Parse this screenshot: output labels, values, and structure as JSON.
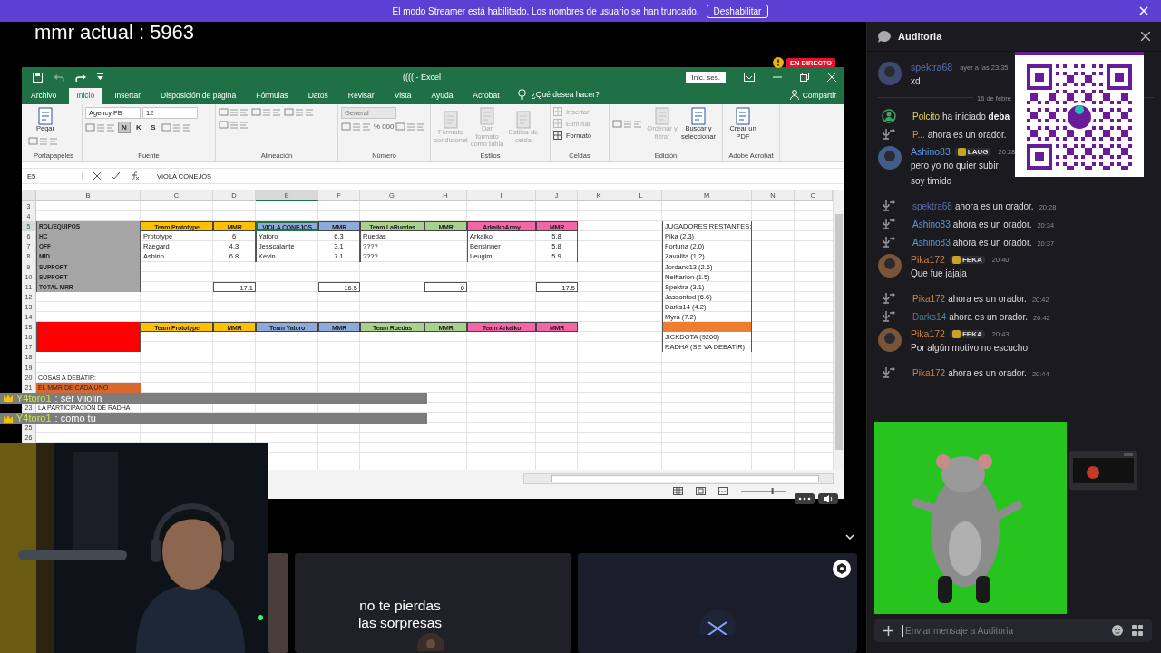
{
  "banner": {
    "text": "El modo Streamer está habilitado. Los nombres de usuario se han truncado.",
    "button": "Deshabilitar"
  },
  "stream": {
    "overlay_text": "mmr actual : 5963",
    "live_badge": "EN DIRECTO",
    "excel": {
      "title": "(((( - Excel",
      "sign_in": "Inic. ses.",
      "tabs": [
        {
          "label": "Archivo",
          "selected": false
        },
        {
          "label": "Inicio",
          "selected": true
        },
        {
          "label": "Insertar",
          "selected": false
        },
        {
          "label": "Disposición de página",
          "selected": false
        },
        {
          "label": "Fórmulas",
          "selected": false
        },
        {
          "label": "Datos",
          "selected": false
        },
        {
          "label": "Revisar",
          "selected": false
        },
        {
          "label": "Vista",
          "selected": false
        },
        {
          "label": "Ayuda",
          "selected": false
        },
        {
          "label": "Acrobat",
          "selected": false
        }
      ],
      "tell_me": "¿Qué desea hacer?",
      "share": "Compartir",
      "ribbon": [
        {
          "label": "Portapapeles",
          "items": [
            {
              "kind": "big",
              "label": "Pegar",
              "disabled": false
            },
            {
              "kind": "tools"
            }
          ]
        },
        {
          "label": "Fuente",
          "items": [
            {
              "kind": "select",
              "value": "Agency FB",
              "disabled": false
            },
            {
              "kind": "select",
              "value": "12",
              "disabled": false
            },
            {
              "kind": "tools"
            },
            {
              "kind": "letter",
              "label": "N",
              "selected": true
            },
            {
              "kind": "letter",
              "label": "K",
              "selected": false
            },
            {
              "kind": "letter",
              "label": "S",
              "selected": false
            },
            {
              "kind": "tools"
            }
          ]
        },
        {
          "label": "Alineación",
          "items": [
            {
              "kind": "tools"
            },
            {
              "kind": "tools"
            },
            {
              "kind": "tools"
            },
            {
              "kind": "tools"
            }
          ]
        },
        {
          "label": "Número",
          "items": [
            {
              "kind": "select",
              "value": "General",
              "disabled": true
            },
            {
              "kind": "tools"
            },
            {
              "kind": "glyph",
              "label": "%"
            },
            {
              "kind": "glyph",
              "label": "000"
            },
            {
              "kind": "tools"
            }
          ]
        },
        {
          "label": "Estilos",
          "items": [
            {
              "kind": "big",
              "label": "Formato condicional",
              "disabled": true
            },
            {
              "kind": "big",
              "label": "Dar formato como tabla",
              "disabled": true
            },
            {
              "kind": "big",
              "label": "Estilos de celda",
              "disabled": true
            }
          ]
        },
        {
          "label": "Celdas",
          "items": [
            {
              "kind": "small",
              "label": "Insertar",
              "disabled": true
            },
            {
              "kind": "small",
              "label": "Eliminar",
              "disabled": true
            },
            {
              "kind": "small",
              "label": "Formato",
              "disabled": false
            }
          ]
        },
        {
          "label": "Edición",
          "items": [
            {
              "kind": "tools"
            },
            {
              "kind": "big",
              "label": "Ordenar y filtrar",
              "disabled": true
            },
            {
              "kind": "big",
              "label": "Buscar y seleccionar",
              "disabled": false
            }
          ]
        },
        {
          "label": "Adobe Acrobat",
          "items": [
            {
              "kind": "big",
              "label": "Crear un PDF",
              "disabled": false
            }
          ]
        }
      ],
      "name_box": "E5",
      "formula": "VIOLA CONEJOS",
      "columns": [
        {
          "letter": "B",
          "selected": false
        },
        {
          "letter": "C",
          "selected": false
        },
        {
          "letter": "D",
          "selected": false
        },
        {
          "letter": "E",
          "selected": true
        },
        {
          "letter": "F",
          "selected": false
        },
        {
          "letter": "G",
          "selected": false
        },
        {
          "letter": "H",
          "selected": false
        },
        {
          "letter": "I",
          "selected": false
        },
        {
          "letter": "J",
          "selected": false
        },
        {
          "letter": "K",
          "selected": false
        },
        {
          "letter": "L",
          "selected": false
        },
        {
          "letter": "M",
          "selected": false
        },
        {
          "letter": "N",
          "selected": false
        },
        {
          "letter": "O",
          "selected": false
        }
      ],
      "rows": [
        {
          "number": "3",
          "selected": false
        },
        {
          "number": "4",
          "selected": false
        },
        {
          "number": "5",
          "selected": true,
          "cells": [
            {
              "kind": "label",
              "text": "ROL/EQUIPOS",
              "color": "#a6a6a6"
            },
            {
              "kind": "header",
              "text": "Team Prototype",
              "color": "#ffc000"
            },
            {
              "kind": "header",
              "text": "MMR",
              "color": "#ffc000"
            },
            {
              "kind": "header",
              "text": "VIOLA CONEJOS",
              "color": "#8eaadb"
            },
            {
              "kind": "header",
              "text": "MMR",
              "color": "#8eaadb"
            },
            {
              "kind": "header",
              "text": "Team LaRuedas",
              "color": "#a9d18e"
            },
            {
              "kind": "header",
              "text": "MMR",
              "color": "#a9d18e"
            },
            {
              "kind": "header",
              "text": "ArkaikoArmy",
              "color": "#f466a8"
            },
            {
              "kind": "header",
              "text": "MMR",
              "color": "#f466a8"
            },
            {},
            {},
            {
              "kind": "list",
              "text": "JUGADORES RESTANTES:"
            }
          ]
        },
        {
          "number": "6",
          "selected": false,
          "cells": [
            {
              "kind": "label",
              "text": "HC",
              "color": "#a6a6a6"
            },
            {
              "kind": "text",
              "text": "Prototype"
            },
            {
              "kind": "number",
              "text": "6"
            },
            {
              "kind": "text",
              "text": "Yatoro"
            },
            {
              "kind": "number",
              "text": "6.3"
            },
            {
              "kind": "text",
              "text": "Ruedas"
            },
            {},
            {
              "kind": "text",
              "text": "Arkaiko"
            },
            {
              "kind": "number",
              "text": "5.8"
            },
            {},
            {},
            {
              "kind": "list",
              "text": "Pika (2.3)"
            }
          ]
        },
        {
          "number": "7",
          "selected": false,
          "cells": [
            {
              "kind": "label",
              "text": "OFF",
              "color": "#a6a6a6"
            },
            {
              "kind": "text",
              "text": "Raegard"
            },
            {
              "kind": "number",
              "text": "4.3"
            },
            {
              "kind": "text",
              "text": "Jesscalante"
            },
            {
              "kind": "number",
              "text": "3.1"
            },
            {
              "kind": "text",
              "text": "????"
            },
            {},
            {
              "kind": "text",
              "text": "Bensinner"
            },
            {
              "kind": "number",
              "text": "5.8"
            },
            {},
            {},
            {
              "kind": "list",
              "text": "Fortuna (2.0)"
            }
          ]
        },
        {
          "number": "8",
          "selected": false,
          "cells": [
            {
              "kind": "label",
              "text": "MID",
              "color": "#a6a6a6"
            },
            {
              "kind": "text",
              "text": "Ashino"
            },
            {
              "kind": "number",
              "text": "6.8"
            },
            {
              "kind": "text",
              "text": "Kevin"
            },
            {
              "kind": "number",
              "text": "7.1"
            },
            {
              "kind": "text",
              "text": "????"
            },
            {},
            {
              "kind": "text",
              "text": "Leugim"
            },
            {
              "kind": "number",
              "text": "5.9"
            },
            {},
            {},
            {
              "kind": "list",
              "text": "Zavalita (1.2)"
            }
          ]
        },
        {
          "number": "9",
          "selected": false,
          "cells": [
            {
              "kind": "label",
              "text": "SUPPORT",
              "color": "#a6a6a6"
            },
            {},
            {},
            {},
            {},
            {},
            {},
            {},
            {},
            {},
            {},
            {
              "kind": "list",
              "text": "Jordanc13 (2.6)"
            }
          ]
        },
        {
          "number": "10",
          "selected": false,
          "cells": [
            {
              "kind": "label",
              "text": "SUPPORT",
              "color": "#a6a6a6"
            },
            {},
            {},
            {},
            {},
            {},
            {},
            {},
            {},
            {},
            {},
            {
              "kind": "list",
              "text": "Nelftarion (1.5)"
            }
          ]
        },
        {
          "number": "11",
          "selected": false,
          "cells": [
            {
              "kind": "label",
              "text": "TOTAL MRR",
              "color": "#a6a6a6"
            },
            {},
            {
              "kind": "total",
              "text": "17.1"
            },
            {},
            {
              "kind": "total",
              "text": "16.5"
            },
            {},
            {
              "kind": "total",
              "text": "0"
            },
            {},
            {
              "kind": "total",
              "text": "17.5"
            },
            {},
            {},
            {
              "kind": "list",
              "text": "Spektra (3.1)"
            }
          ]
        },
        {
          "number": "12",
          "selected": false,
          "cells": [
            {},
            {},
            {},
            {},
            {},
            {},
            {},
            {},
            {},
            {},
            {},
            {
              "kind": "list",
              "text": "Jassontod (6.6)"
            }
          ]
        },
        {
          "number": "13",
          "selected": false,
          "cells": [
            {},
            {},
            {},
            {},
            {},
            {},
            {},
            {},
            {},
            {},
            {},
            {
              "kind": "list",
              "text": "Darks14 (4.2)"
            }
          ]
        },
        {
          "number": "14",
          "selected": false,
          "cells": [
            {},
            {},
            {},
            {},
            {},
            {},
            {},
            {},
            {},
            {},
            {},
            {
              "kind": "list",
              "text": "Myra (7.2)"
            }
          ]
        },
        {
          "number": "15",
          "selected": false,
          "cells": [
            {
              "kind": "label",
              "color": "#ff0000"
            },
            {
              "kind": "header",
              "text": "Team Prototype",
              "color": "#ffc000"
            },
            {
              "kind": "header",
              "text": "MMR",
              "color": "#ffc000"
            },
            {
              "kind": "header",
              "text": "Team Yatoro",
              "color": "#8eaadb"
            },
            {
              "kind": "header",
              "text": "MMR",
              "color": "#8eaadb"
            },
            {
              "kind": "header",
              "text": "Team Ruedas",
              "color": "#a9d18e"
            },
            {
              "kind": "header",
              "text": "MMR",
              "color": "#a9d18e"
            },
            {
              "kind": "header",
              "text": "Team Arkaiko",
              "color": "#f466a8"
            },
            {
              "kind": "header",
              "text": "MMR",
              "color": "#f466a8"
            },
            {},
            {},
            {
              "kind": "list",
              "color": "#ed7d31"
            }
          ]
        },
        {
          "number": "16",
          "selected": false,
          "cells": [
            {
              "kind": "label",
              "color": "#ff0000"
            },
            {},
            {},
            {},
            {},
            {},
            {},
            {},
            {},
            {},
            {},
            {
              "kind": "list",
              "text": "JICKDOTA (9200)"
            }
          ]
        },
        {
          "number": "17",
          "selected": false,
          "cells": [
            {
              "kind": "label",
              "color": "#ff0000"
            },
            {},
            {},
            {},
            {},
            {},
            {},
            {},
            {},
            {},
            {},
            {
              "kind": "list",
              "text": "RADHA (SE VA DEBATIR)"
            }
          ]
        },
        {
          "number": "18",
          "selected": false
        },
        {
          "number": "19",
          "selected": false
        },
        {
          "number": "20",
          "selected": false,
          "cells": [
            {
              "kind": "note",
              "text": "COSAS A DEBATIR:"
            }
          ]
        },
        {
          "number": "21",
          "selected": false,
          "cells": [
            {
              "kind": "note",
              "text": "EL MMR DE CADA UNO",
              "color": "#d8692e"
            }
          ]
        },
        {},
        {
          "number": "23",
          "selected": false,
          "cells": [
            {
              "kind": "note",
              "text": "LA PARTICIPACIÓN DE RADHA"
            }
          ]
        },
        {},
        {
          "number": "25",
          "selected": false
        },
        {
          "number": "26",
          "selected": false
        }
      ],
      "zoom_slider": {
        "level": 0.7
      }
    },
    "stream_chat": [
      {
        "author": "Y4toro1",
        "text": ": ser viiolin"
      },
      {
        "author": "Y4toro1",
        "text": ": como tu"
      }
    ],
    "caption": "no te pierdas las sorpresas"
  },
  "panel": {
    "title": "Auditoria",
    "messages": [
      {
        "kind": "message",
        "author": "spektra68",
        "color": "#5a6fb0",
        "time": "ayer a las 23:35",
        "lines": [
          "xd"
        ]
      },
      {
        "kind": "divider",
        "text": "16 de febre"
      },
      {
        "kind": "event",
        "author": "Polcito",
        "color": "#e3d35b",
        "text": "ha iniciado **deba**"
      },
      {
        "kind": "system",
        "author": "P...",
        "color": "#d9894e",
        "text": "ahora es un orador."
      },
      {
        "kind": "message",
        "author": "Ashino83",
        "color": "#5f95e0",
        "badge": "LAUG",
        "time": "20:28",
        "lines": [
          "pero yo no quier subir",
          "soy timido"
        ]
      },
      {
        "kind": "system",
        "author": "spektra68",
        "color": "#5a6fb0",
        "text": "ahora es un orador.",
        "time": "20:28"
      },
      {
        "kind": "system",
        "author": "Ashino83",
        "color": "#5f95e0",
        "text": "ahora es un orador.",
        "time": "20:34"
      },
      {
        "kind": "system",
        "author": "Ashino83",
        "color": "#5f95e0",
        "text": "ahora es un orador.",
        "time": "20:37"
      },
      {
        "kind": "message",
        "author": "Pika172",
        "color": "#c9834f",
        "badge": "FEKA",
        "time": "20:40",
        "lines": [
          "Que fue jajaja"
        ]
      },
      {
        "kind": "system",
        "author": "Pika172",
        "color": "#c9834f",
        "text": "ahora es un orador.",
        "time": "20:42"
      },
      {
        "kind": "system",
        "author": "Darks14",
        "color": "#4f7f93",
        "text": "ahora es un orador.",
        "time": "20:42"
      },
      {
        "kind": "message",
        "author": "Pika172",
        "color": "#c9834f",
        "badge": "FEKA",
        "time": "20:43",
        "lines": [
          "Por algún motivo no escucho"
        ]
      },
      {
        "kind": "system",
        "author": "Pika172",
        "color": "#c9834f",
        "text": "ahora es un orador.",
        "time": "20:44"
      }
    ],
    "input": {
      "placeholder": "Enviar mensaje a Auditoria"
    }
  }
}
